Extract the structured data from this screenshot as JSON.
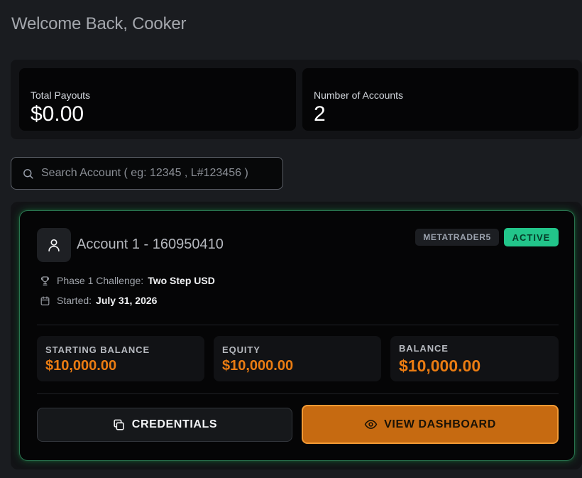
{
  "header": {
    "welcome": "Welcome Back, Cooker"
  },
  "stats": [
    {
      "label": "Total Payouts",
      "value": "$0.00"
    },
    {
      "label": "Number of Accounts",
      "value": "2"
    }
  ],
  "search": {
    "placeholder": "Search Account ( eg: 12345 , L#123456 )",
    "value": ""
  },
  "account": {
    "title": "Account 1 - 160950410",
    "platform": "METATRADER5",
    "status": "ACTIVE",
    "phase_label": "Phase 1 Challenge:",
    "phase_value": "Two Step USD",
    "started_label": "Started:",
    "started_value": "July 31, 2026",
    "balances": [
      {
        "label": "STARTING BALANCE",
        "value": "$10,000.00"
      },
      {
        "label": "EQUITY",
        "value": "$10,000.00"
      },
      {
        "label": "BALANCE",
        "value": "$10,000.00"
      }
    ],
    "credentials_label": "CREDENTIALS",
    "dashboard_label": "VIEW DASHBOARD"
  },
  "colors": {
    "accent_orange": "#ea7c12",
    "active_green": "#22c58a",
    "card_glow": "#29734f"
  },
  "icons": {
    "search": "search-icon",
    "user": "user-icon",
    "phase": "trophy-icon",
    "started": "calendar-icon",
    "credentials": "copy-icon",
    "dashboard": "eye-icon"
  }
}
